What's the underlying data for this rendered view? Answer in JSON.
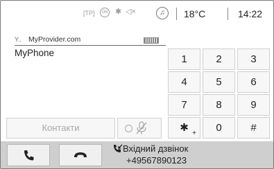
{
  "status_bar": {
    "tp": "[TP]",
    "on_badge": "ON",
    "icons": [
      "bluetooth-icon",
      "mute-icon",
      "media-note-icon"
    ],
    "temperature": "18°C",
    "time": "14:22"
  },
  "phone": {
    "provider": "MyProvider.com",
    "device_name": "MyPhone"
  },
  "controls": {
    "contacts_label": "Контакти"
  },
  "keypad": {
    "keys": [
      {
        "label": "1"
      },
      {
        "label": "2"
      },
      {
        "label": "3"
      },
      {
        "label": "4"
      },
      {
        "label": "5"
      },
      {
        "label": "6"
      },
      {
        "label": "7"
      },
      {
        "label": "8"
      },
      {
        "label": "9"
      },
      {
        "label": "✱",
        "sub": "+"
      },
      {
        "label": "0"
      },
      {
        "label": "#"
      }
    ]
  },
  "call": {
    "status": "Вхідний дзвінок",
    "number": "+49567890123"
  },
  "colors": {
    "bar_bg": "#cfcfcf",
    "key_bg": "#f7f7f7",
    "border": "#cfcfcf"
  }
}
